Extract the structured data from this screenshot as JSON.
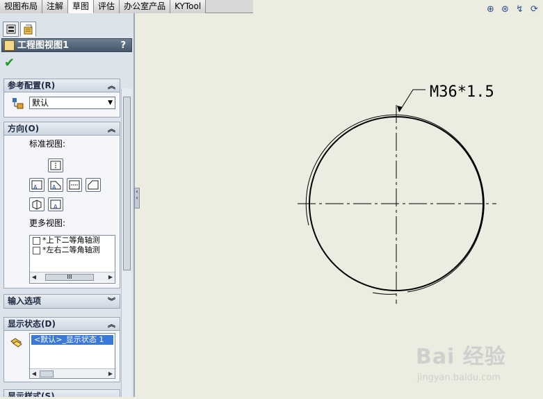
{
  "tabs": [
    "视图布局",
    "注解",
    "草图",
    "评估",
    "办公室产品",
    "KYTool"
  ],
  "active_tab_index": 2,
  "panel": {
    "title": "工程图视图1",
    "help": "?",
    "ok": "✔",
    "ref_config": {
      "header": "参考配置(R)",
      "value": "默认"
    },
    "orientation": {
      "header": "方向(O)",
      "std_views_label": "标准视图:",
      "more_views_label": "更多视图:",
      "more_views": [
        "*上下二等角轴测",
        "*左右二等角轴测"
      ],
      "scroll_thumb": "III"
    },
    "import_options": {
      "header": "输入选项"
    },
    "display_state": {
      "header": "显示状态(D)",
      "selected": "<默认>_显示状态 1"
    },
    "display_style": {
      "header": "显示样式(S)"
    }
  },
  "drawing": {
    "callout_text": "M36*1.5"
  },
  "watermark": {
    "brand": "Bai  经验",
    "url": "jingyan.baidu.com"
  },
  "colors": {
    "panel_bg": "#dde3ea",
    "canvas_bg": "#ecece0",
    "title_bar": "#45566a",
    "ok_green": "#1f9a1f",
    "selection": "#3b78d8"
  }
}
